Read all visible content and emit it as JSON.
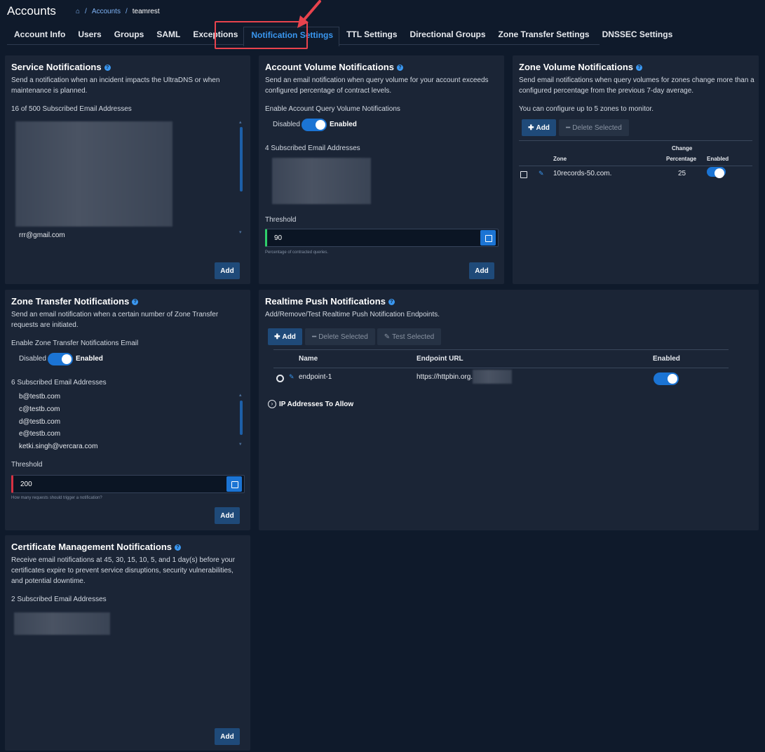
{
  "header": {
    "title": "Accounts",
    "breadcrumb": {
      "link": "Accounts",
      "current": "teamrest"
    }
  },
  "tabs": [
    "Account Info",
    "Users",
    "Groups",
    "SAML",
    "Exceptions",
    "Notification Settings",
    "TTL Settings",
    "Directional Groups",
    "Zone Transfer Settings",
    "DNSSEC Settings"
  ],
  "service": {
    "title": "Service Notifications",
    "desc": "Send a notification when an incident impacts the UltraDNS or when maintenance is planned.",
    "count": "16 of 500 Subscribed Email Addresses",
    "visible_email": "rrr@gmail.com",
    "add": "Add"
  },
  "account_volume": {
    "title": "Account Volume Notifications",
    "desc": "Send an email notification when query volume for your account exceeds configured percentage of contract levels.",
    "enable_label": "Enable Account Query Volume Notifications",
    "disabled": "Disabled",
    "enabled": "Enabled",
    "count": "4 Subscribed Email Addresses",
    "threshold_label": "Threshold",
    "threshold_value": "90",
    "threshold_hint": "Percentage of contracted queries.",
    "add": "Add"
  },
  "zone_volume": {
    "title": "Zone Volume Notifications",
    "desc": "Send email notifications when query volumes for zones change more than a configured percentage from the previous 7-day average.",
    "limit": "You can configure up to 5 zones to monitor.",
    "add": "Add",
    "delete": "Delete Selected",
    "col_zone": "Zone",
    "col_change1": "Change",
    "col_change2": "Percentage",
    "col_enabled": "Enabled",
    "rows": [
      {
        "zone": "10records-50.com.",
        "pct": "25"
      }
    ]
  },
  "zone_transfer": {
    "title": "Zone Transfer Notifications",
    "desc": "Send an email notification when a certain number of Zone Transfer requests are initiated.",
    "enable_label": "Enable Zone Transfer Notifications Email",
    "disabled": "Disabled",
    "enabled": "Enabled",
    "count": "6 Subscribed Email Addresses",
    "emails": [
      "b@testb.com",
      "c@testb.com",
      "d@testb.com",
      "e@testb.com",
      "ketki.singh@vercara.com"
    ],
    "threshold_label": "Threshold",
    "threshold_value": "200",
    "threshold_hint": "How many requests should trigger a notification?",
    "add": "Add"
  },
  "realtime": {
    "title": "Realtime Push Notifications",
    "desc": "Add/Remove/Test Realtime Push Notification Endpoints.",
    "add": "Add",
    "delete": "Delete Selected",
    "test": "Test Selected",
    "col_name": "Name",
    "col_url": "Endpoint URL",
    "col_enabled": "Enabled",
    "rows": [
      {
        "name": "endpoint-1",
        "url": "https://httpbin.org."
      }
    ],
    "ip_toggle": "IP Addresses To Allow"
  },
  "certificate": {
    "title": "Certificate Management Notifications",
    "desc": "Receive email notifications at 45, 30, 15, 10, 5, and 1 day(s) before your certificates expire to prevent service disruptions, security vulnerabilities, and potential downtime.",
    "count": "2 Subscribed Email Addresses",
    "add": "Add"
  }
}
